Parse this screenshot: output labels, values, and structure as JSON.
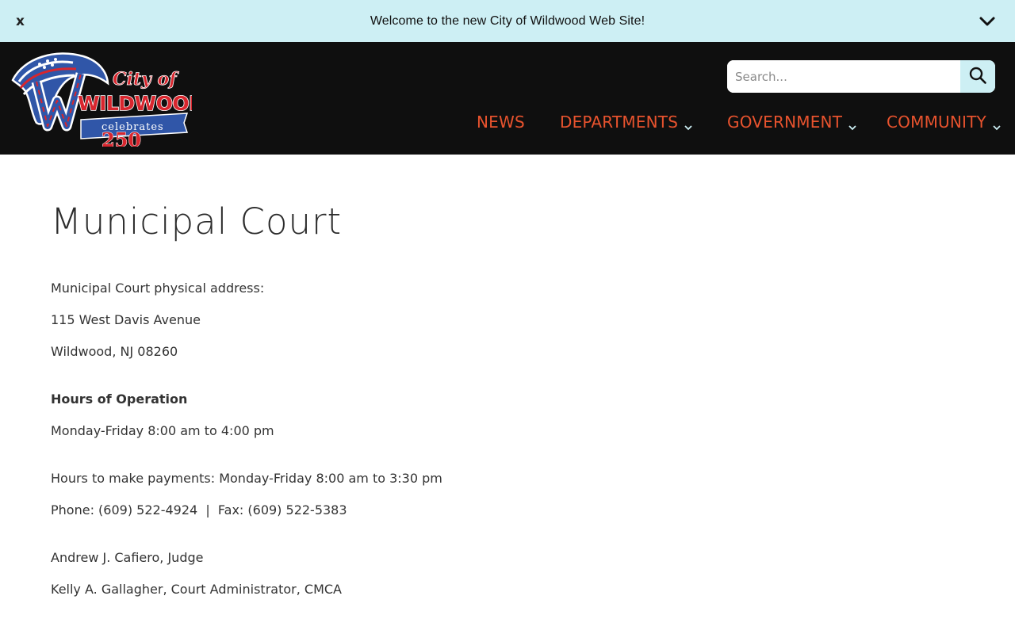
{
  "announcement": {
    "close_label": "x",
    "text": "Welcome to the new City of Wildwood Web Site!",
    "toggle_icon": "chevron-down-icon"
  },
  "logo": {
    "line1": "City of",
    "line2": "WILDWOOD",
    "line3": "celebrates",
    "line4": "250"
  },
  "search": {
    "placeholder": "Search...",
    "value": "",
    "icon": "search-icon"
  },
  "nav": {
    "items": [
      {
        "label": "NEWS",
        "has_dropdown": false
      },
      {
        "label": "DEPARTMENTS",
        "has_dropdown": true
      },
      {
        "label": "GOVERNMENT",
        "has_dropdown": true
      },
      {
        "label": "COMMUNITY",
        "has_dropdown": true
      }
    ]
  },
  "page": {
    "title": "Municipal Court",
    "address_label": "Municipal Court physical address:",
    "address_street": "115 West Davis Avenue",
    "address_city": "Wildwood, NJ 08260",
    "hours_heading": "Hours of Operation",
    "hours": "Monday-Friday 8:00 am to 4:00 pm",
    "payment_hours": "Hours to make payments: Monday-Friday 8:00 am to 3:30 pm",
    "phone_fax": "Phone: (609) 522-4924  |  Fax: (609) 522-5383",
    "judge": "Andrew J. Cafiero, Judge",
    "administrator": "Kelly A. Gallagher, Court Administrator, CMCA"
  },
  "colors": {
    "announcement_bg": "#cdeff4",
    "header_bg": "#0f0f0f",
    "nav_text": "#e8532e",
    "logo_blue": "#3056a8",
    "logo_red": "#d8262e"
  }
}
